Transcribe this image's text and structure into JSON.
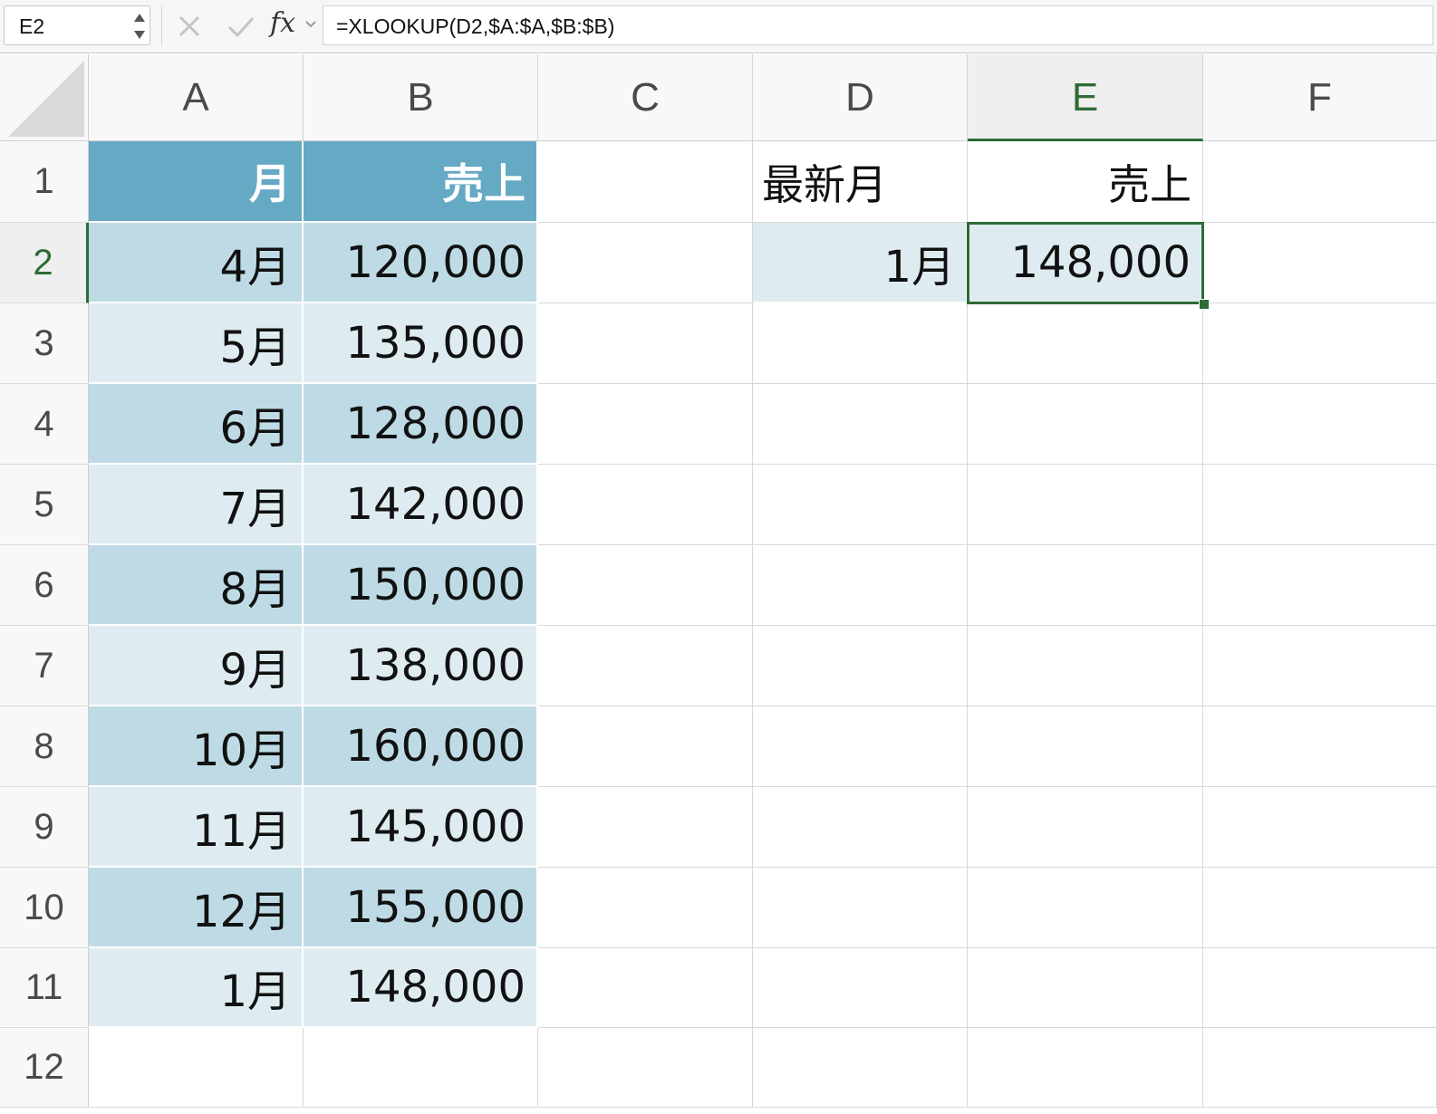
{
  "formula_bar": {
    "name_box": "E2",
    "cancel_icon": "close-icon",
    "enter_icon": "check-icon",
    "fx_label": "fx",
    "formula": "=XLOOKUP(D2,$A:$A,$B:$B)"
  },
  "columns": [
    "A",
    "B",
    "C",
    "D",
    "E",
    "F"
  ],
  "active_column": "E",
  "active_row": "2",
  "rows": [
    "1",
    "2",
    "3",
    "4",
    "5",
    "6",
    "7",
    "8",
    "9",
    "10",
    "11",
    "12"
  ],
  "cells": {
    "A1": "月",
    "B1": "売上",
    "A2": "4月",
    "B2": "120,000",
    "A3": "5月",
    "B3": "135,000",
    "A4": "6月",
    "B4": "128,000",
    "A5": "7月",
    "B5": "142,000",
    "A6": "8月",
    "B6": "150,000",
    "A7": "9月",
    "B7": "138,000",
    "A8": "10月",
    "B8": "160,000",
    "A9": "11月",
    "B9": "145,000",
    "A10": "12月",
    "B10": "155,000",
    "A11": "1月",
    "B11": "148,000",
    "D1": "最新月",
    "E1": "売上",
    "D2": "1月",
    "E2": "148,000"
  },
  "colors": {
    "table_header": "#65a9c4",
    "band_dark": "#bedbe5",
    "band_light": "#deecf1",
    "selection": "#2e6b35"
  }
}
